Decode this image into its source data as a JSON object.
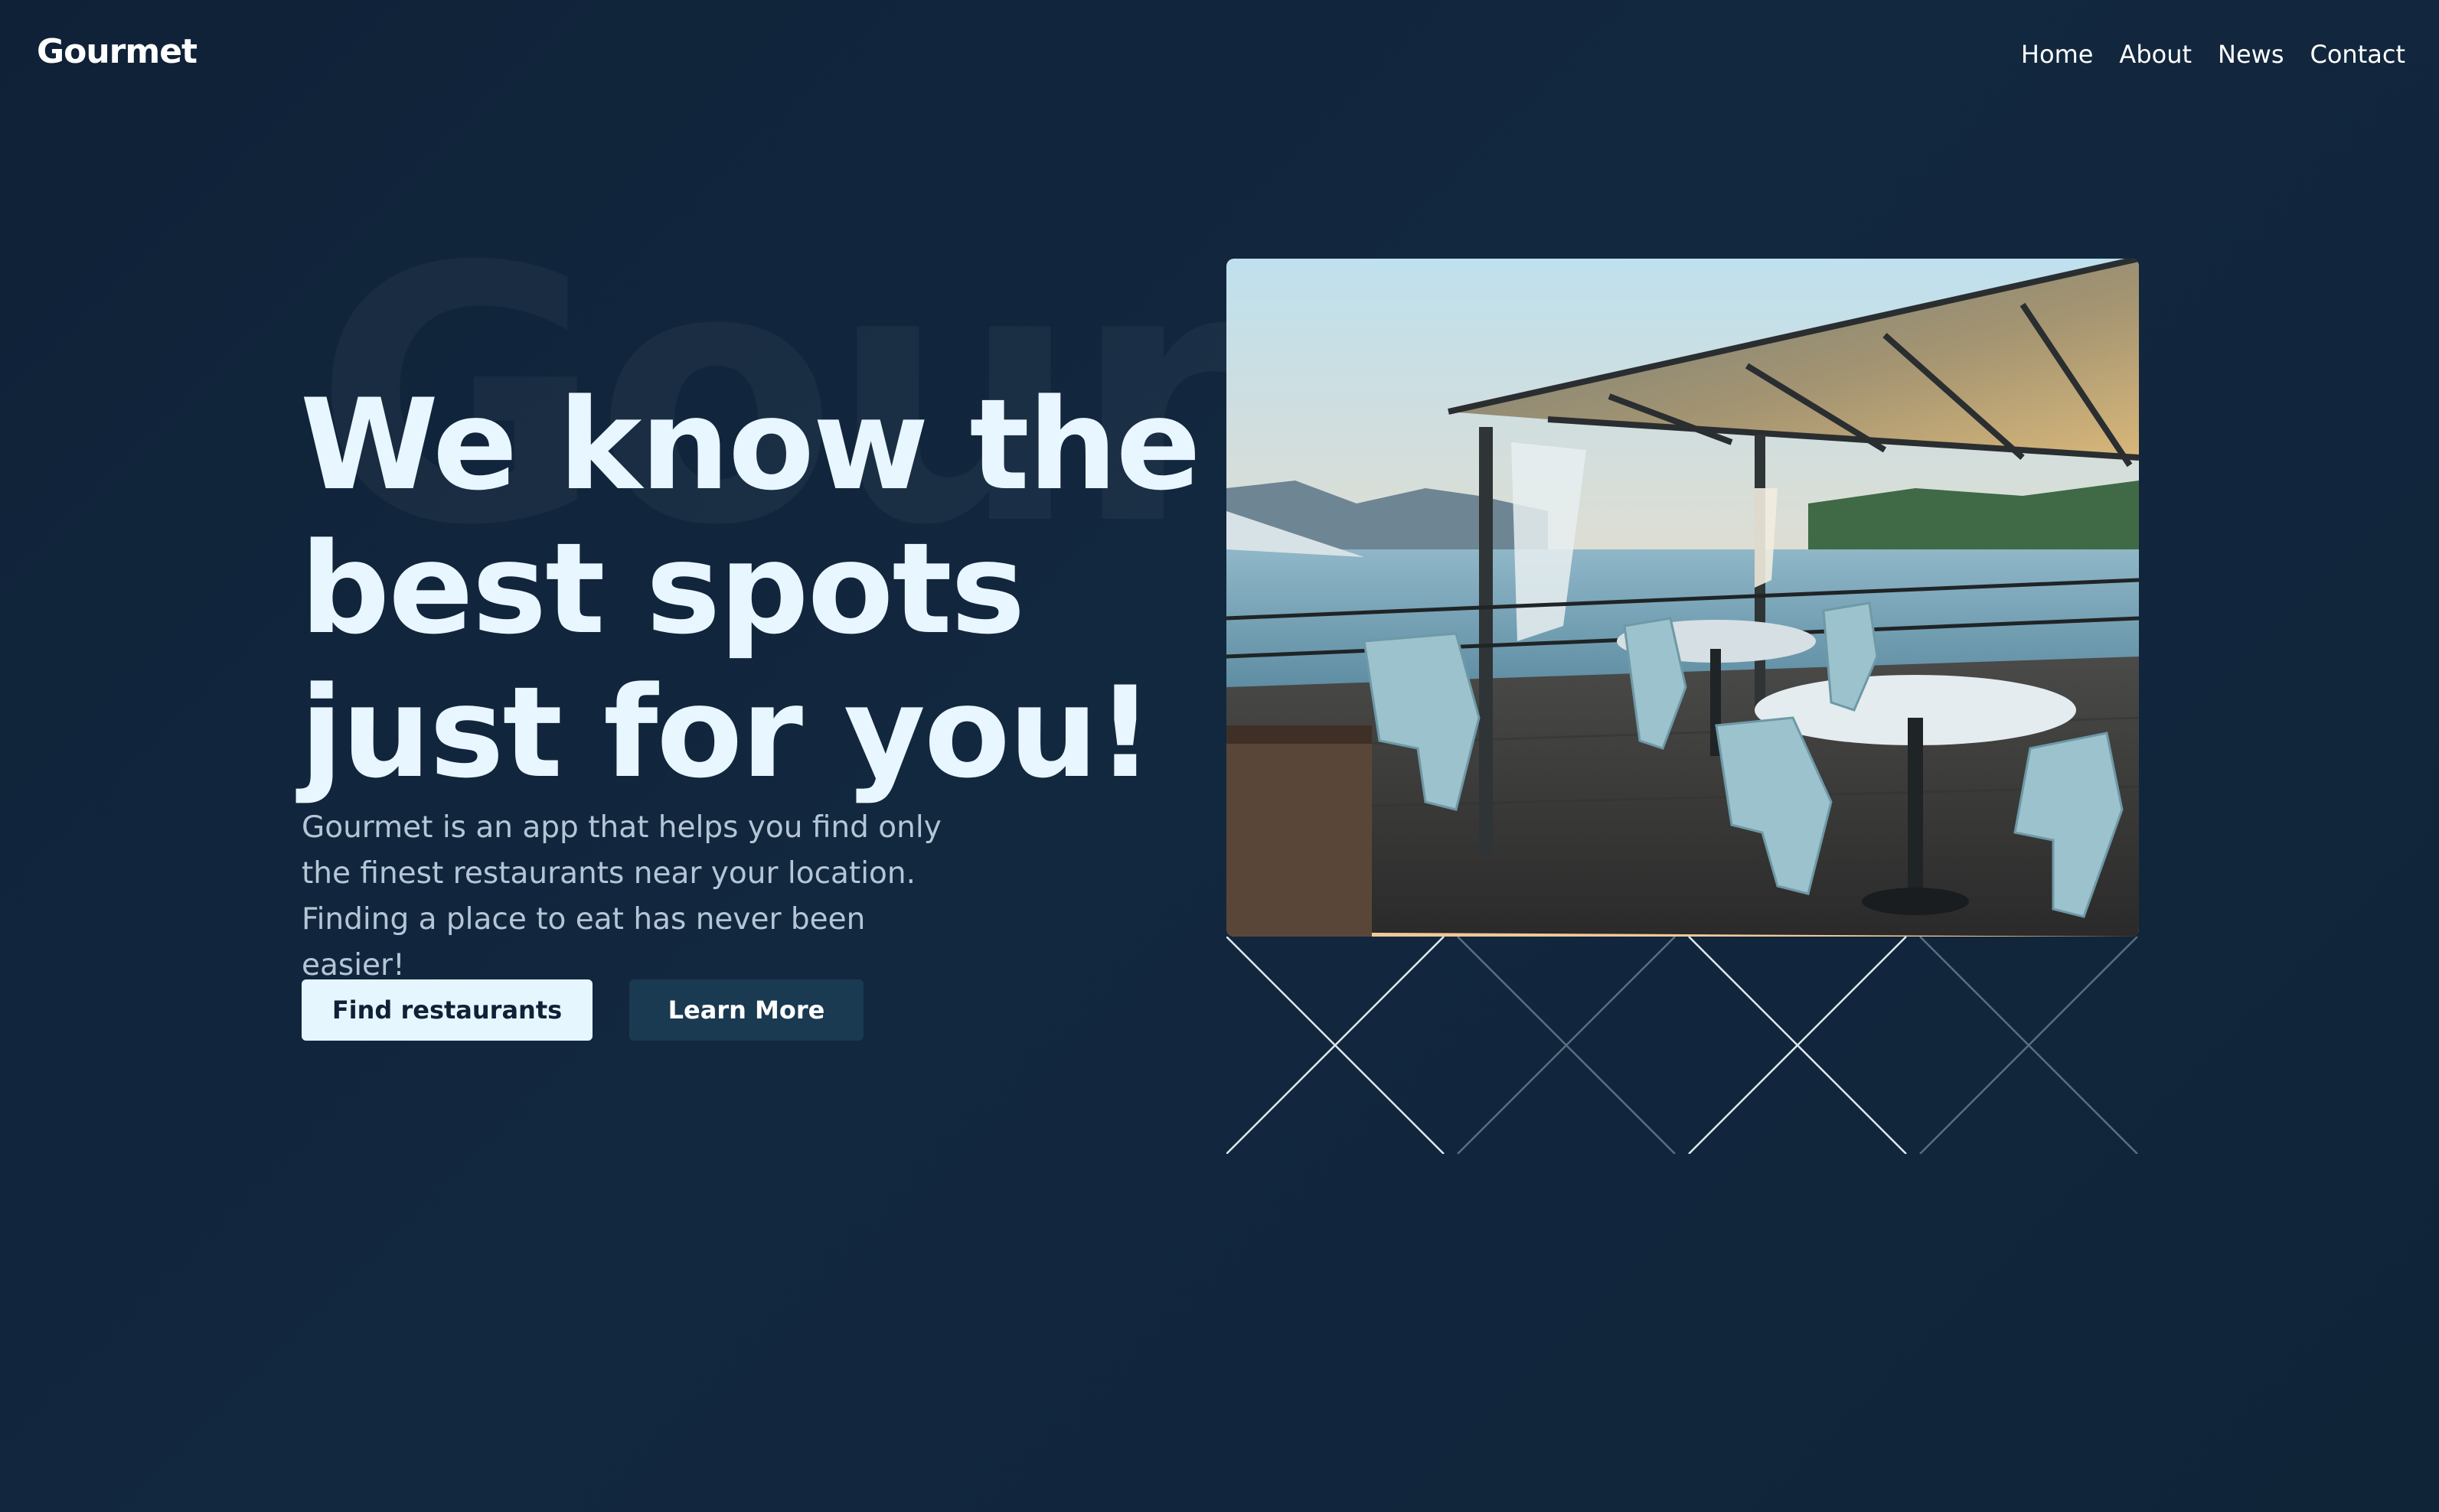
{
  "brand": {
    "logo": "Gourmet"
  },
  "nav": {
    "items": [
      {
        "label": "Home"
      },
      {
        "label": "About"
      },
      {
        "label": "News"
      },
      {
        "label": "Contact"
      }
    ]
  },
  "hero": {
    "watermark": "Gourmet",
    "title": "We know the best spots just for you!",
    "description": "Gourmet is an app that helps you find only the finest restaurants near your location. Finding a place to eat has never been easier!",
    "primary_button": "Find restaurants",
    "secondary_button": "Learn More"
  },
  "colors": {
    "background": "#0f2137",
    "title": "#e8f6ff",
    "primary_button": "#e6f6ff",
    "secondary_button": "#1a3a52"
  }
}
